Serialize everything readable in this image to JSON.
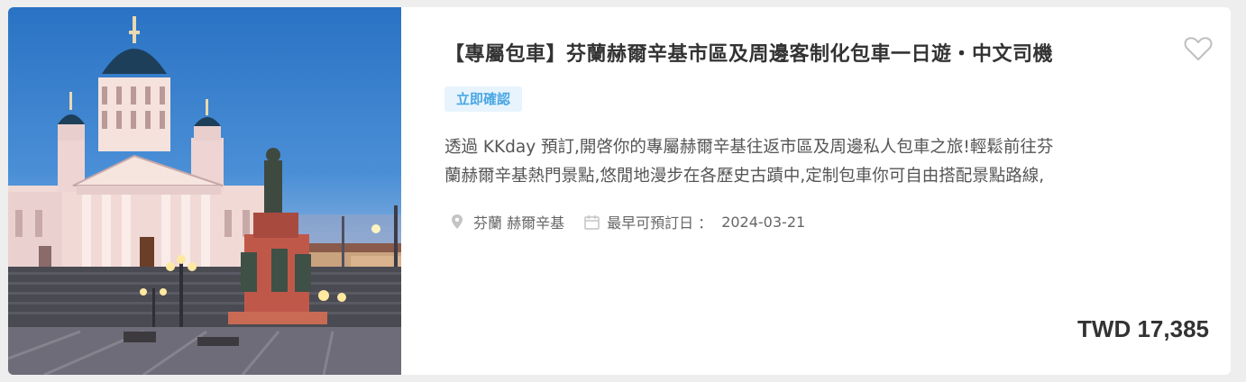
{
  "product": {
    "title": "【專屬包車】芬蘭赫爾辛基市區及周邊客制化包車一日遊・中文司機",
    "badge": "立即確認",
    "description_line1": "透過 KKday 預訂,開啓你的專屬赫爾辛基往返市區及周邊私人包車之旅!輕鬆前往芬",
    "description_line2": "蘭赫爾辛基熱門景點,悠閒地漫步在各歷史古蹟中,定制包車你可自由搭配景點路線,",
    "location": "芬蘭 赫爾辛基",
    "earliest_booking_label": "最早可預訂日 ：",
    "earliest_booking_date": "2024-03-21",
    "price": "TWD 17,385"
  },
  "icons": {
    "wishlist": "heart-outline-icon",
    "location": "map-pin-icon",
    "date": "calendar-icon"
  },
  "colors": {
    "badge_bg": "#e7f4fd",
    "badge_text": "#4aa7e4",
    "title": "#333333",
    "body_text": "#555555"
  }
}
